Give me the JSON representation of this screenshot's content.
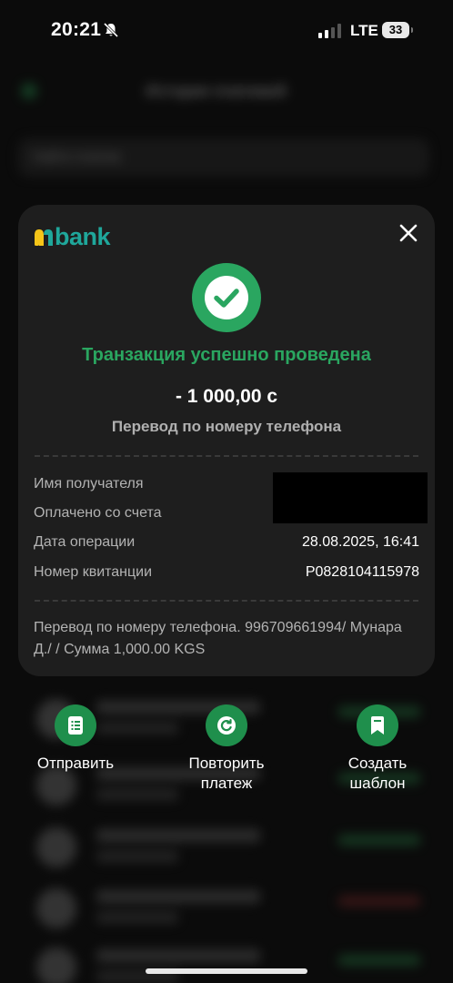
{
  "status_bar": {
    "time": "20:21",
    "network": "LTE",
    "battery": "33"
  },
  "background": {
    "header_title": "История платежей",
    "search_placeholder": "Найти платеж"
  },
  "receipt": {
    "brand": "bank",
    "status_text": "Транзакция успешно проведена",
    "amount": "- 1 000,00 с",
    "transfer_type": "Перевод по номеру телефона",
    "details": [
      {
        "label": "Имя получателя",
        "value": ""
      },
      {
        "label": "Оплачено со счета",
        "value": ""
      },
      {
        "label": "Дата операции",
        "value": "28.08.2025, 16:41"
      },
      {
        "label": "Номер квитанции",
        "value": "P0828104115978"
      }
    ],
    "note": "Перевод по номеру телефона. 996709661994/ Мунара Д./  / Сумма 1,000.00 KGS"
  },
  "actions": {
    "send_label": "Отправить",
    "repeat_label": "Повторить платеж",
    "template_label": "Создать шаблон"
  },
  "colors": {
    "accent_green": "#2aa660",
    "button_green": "#1f8f4c",
    "brand_teal": "#1fa79b",
    "brand_yellow": "#f5c518",
    "card_bg": "#1e1e1e"
  },
  "icons": {
    "success": "check-circle-icon",
    "close": "close-icon",
    "send": "document-list-icon",
    "repeat": "repeat-icon",
    "template": "bookmark-icon"
  }
}
